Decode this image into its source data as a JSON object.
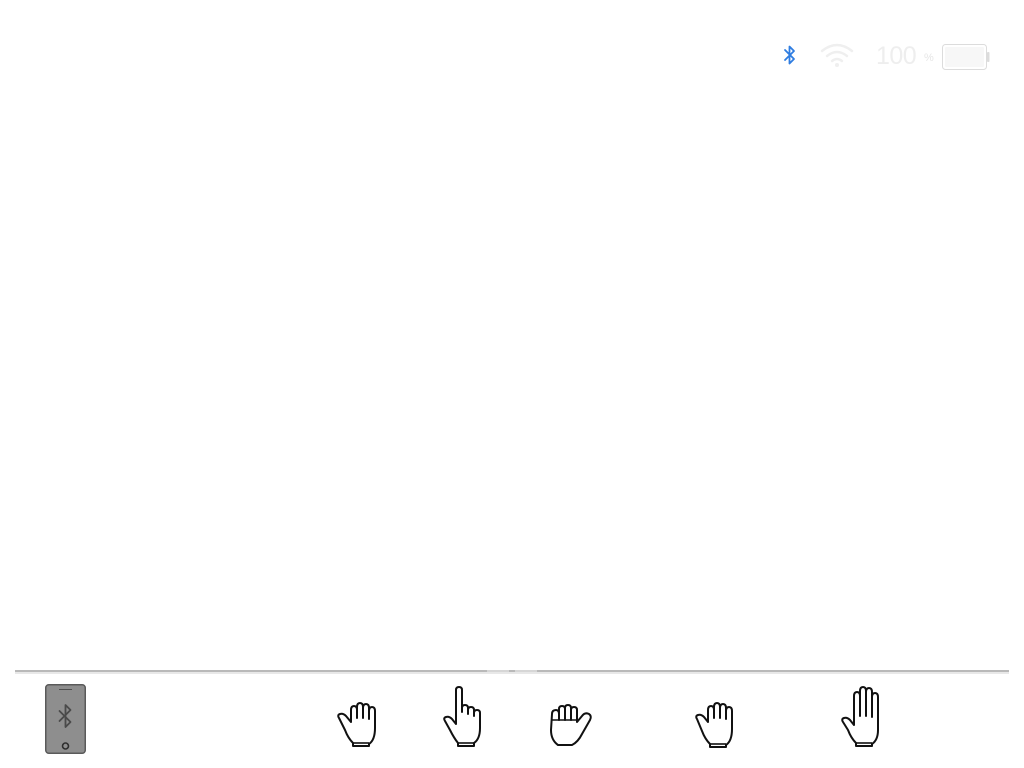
{
  "status_bar": {
    "bluetooth_icon": "bluetooth-icon",
    "wifi_icon": "wifi-icon",
    "battery_percent": "100",
    "battery_unit": "%",
    "battery_level": 1.0,
    "battery_icon": "battery-icon",
    "colors": {
      "bluetooth": "#2f7de1",
      "wifi": "#efefef",
      "battery_text": "#eeeeee"
    }
  },
  "tray": {
    "device_button": {
      "icon": "phone-bluetooth-icon",
      "colors": {
        "body": "#8e8e8e",
        "outline": "#5a5a5a"
      }
    },
    "gestures": [
      {
        "icon": "open-hand-fingers-curled-icon"
      },
      {
        "icon": "pointing-finger-icon"
      },
      {
        "icon": "fist-thumb-out-icon"
      },
      {
        "icon": "curled-hand-icon"
      },
      {
        "icon": "open-palm-icon"
      }
    ]
  }
}
